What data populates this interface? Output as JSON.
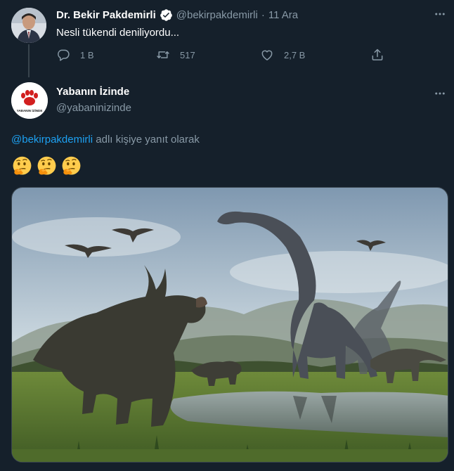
{
  "parent_tweet": {
    "author_name": "Dr. Bekir Pakdemirli",
    "handle": "@bekirpakdemirli",
    "separator": "·",
    "date": "11 Ara",
    "text": "Nesli tükendi deniliyordu...",
    "verified_icon": "verified-badge-icon",
    "actions": {
      "reply_count": "1 B",
      "retweet_count": "517",
      "like_count": "2,7 B"
    }
  },
  "reply_tweet": {
    "author_name": "Yabanın İzinde",
    "handle": "@yabaninizinde",
    "avatar_text": "YABANIN İZİNDE",
    "reply_to_mention": "@bekirpakdemirli",
    "reply_to_suffix": "adlı kişiye yanıt olarak",
    "emojis": [
      "thinking-face",
      "thinking-face",
      "thinking-face"
    ]
  },
  "colors": {
    "background": "#15202b",
    "accent": "#1da1f2",
    "muted": "#8899a6",
    "border": "#38444d"
  }
}
